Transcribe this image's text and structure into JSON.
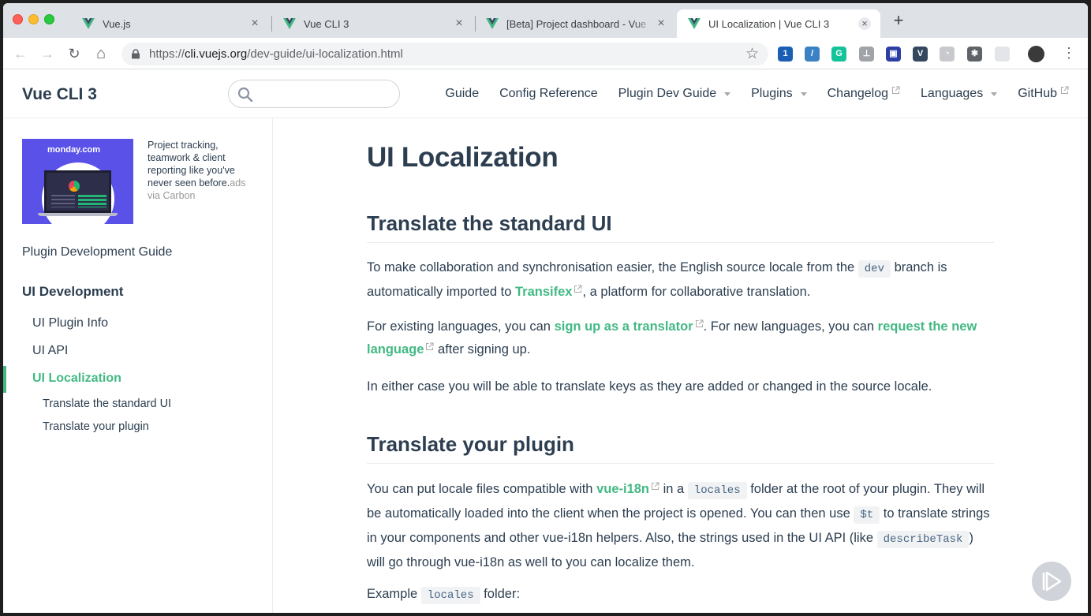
{
  "browser": {
    "tabs": [
      {
        "label": "Vue.js",
        "close": "×",
        "active": false
      },
      {
        "label": "Vue CLI 3",
        "close": "×",
        "active": false
      },
      {
        "label": "[Beta] Project dashboard - Vue",
        "close": "×",
        "active": false
      },
      {
        "label": "UI Localization | Vue CLI 3",
        "close": "×",
        "active": true
      }
    ],
    "new_tab": "+",
    "nav": {
      "back": "←",
      "forward": "→",
      "reload": "↻",
      "home": "⌂"
    },
    "url_scheme": "https://",
    "url_host": "cli.vuejs.org",
    "url_path": "/dev-guide/ui-localization.html",
    "bookmark_icon": "☆",
    "extensions": [
      {
        "name": "1password-icon",
        "glyph": "1",
        "color": "#1a5fb4"
      },
      {
        "name": "edge-ext-icon",
        "glyph": "/",
        "color": "#3b82c4"
      },
      {
        "name": "grammarly-icon",
        "glyph": "G",
        "color": "#15c39a"
      },
      {
        "name": "sitemap-icon",
        "glyph": "⊥",
        "color": "#a0a4a8"
      },
      {
        "name": "bookmark-ext-icon",
        "glyph": "▣",
        "color": "#2d3ea6"
      },
      {
        "name": "vue-devtools-icon",
        "glyph": "V",
        "color": "#35495e"
      },
      {
        "name": "timer-icon",
        "glyph": "◔",
        "color": "#c7c9cc"
      },
      {
        "name": "puzzle-icon",
        "glyph": "✱",
        "color": "#5f6368"
      },
      {
        "name": "blank-ext-icon",
        "glyph": "",
        "color": "#e3e5e8"
      },
      {
        "name": "profile-avatar-icon",
        "glyph": "",
        "color": "#3a3a3a"
      }
    ],
    "menu": "⋮"
  },
  "navbar": {
    "title": "Vue CLI 3",
    "search_placeholder": "",
    "links": [
      {
        "label": "Guide",
        "type": "plain"
      },
      {
        "label": "Config Reference",
        "type": "plain"
      },
      {
        "label": "Plugin Dev Guide",
        "type": "dropdown"
      },
      {
        "label": "Plugins",
        "type": "dropdown"
      },
      {
        "label": "Changelog",
        "type": "external"
      },
      {
        "label": "Languages",
        "type": "dropdown"
      },
      {
        "label": "GitHub",
        "type": "external"
      }
    ]
  },
  "ad": {
    "brand": "monday.com",
    "text": "Project tracking, teamwork & client reporting like you've never seen before.",
    "via": "ads via Carbon"
  },
  "sidebar": {
    "group": "Plugin Development Guide",
    "heading": "UI Development",
    "items": [
      {
        "label": "UI Plugin Info",
        "active": false
      },
      {
        "label": "UI API",
        "active": false
      },
      {
        "label": "UI Localization",
        "active": true
      }
    ],
    "subitems": [
      "Translate the standard UI",
      "Translate your plugin"
    ]
  },
  "content": {
    "title": "UI Localization",
    "section1": {
      "heading": "Translate the standard UI",
      "p1": {
        "a": "To make collaboration and synchronisation easier, the English source locale from the ",
        "code": "dev",
        "b": " branch is automatically imported to ",
        "link": "Transifex",
        "c": ", a platform for collaborative translation."
      },
      "p2": {
        "a": "For existing languages, you can ",
        "link1": "sign up as a translator",
        "b": ". For new languages, you can ",
        "link2": "request the new language",
        "c": " after signing up."
      },
      "p3": "In either case you will be able to translate keys as they are added or changed in the source locale."
    },
    "section2": {
      "heading": "Translate your plugin",
      "p1": {
        "a": "You can put locale files compatible with ",
        "link": "vue-i18n",
        "b": " in a ",
        "code1": "locales",
        "c": " folder at the root of your plugin. They will be automatically loaded into the client when the project is opened. You can then use ",
        "code2": "$t",
        "d": " to translate strings in your components and other vue-i18n helpers. Also, the strings used in the UI API (like ",
        "code3": "describeTask",
        "e": ") will go through vue-i18n as well to you can localize them."
      },
      "p2": {
        "a": "Example ",
        "code": "locales",
        "b": " folder:"
      }
    }
  },
  "colors": {
    "accent": "#42b983",
    "text": "#2c3e50",
    "code_bg": "#f0f2f4"
  }
}
